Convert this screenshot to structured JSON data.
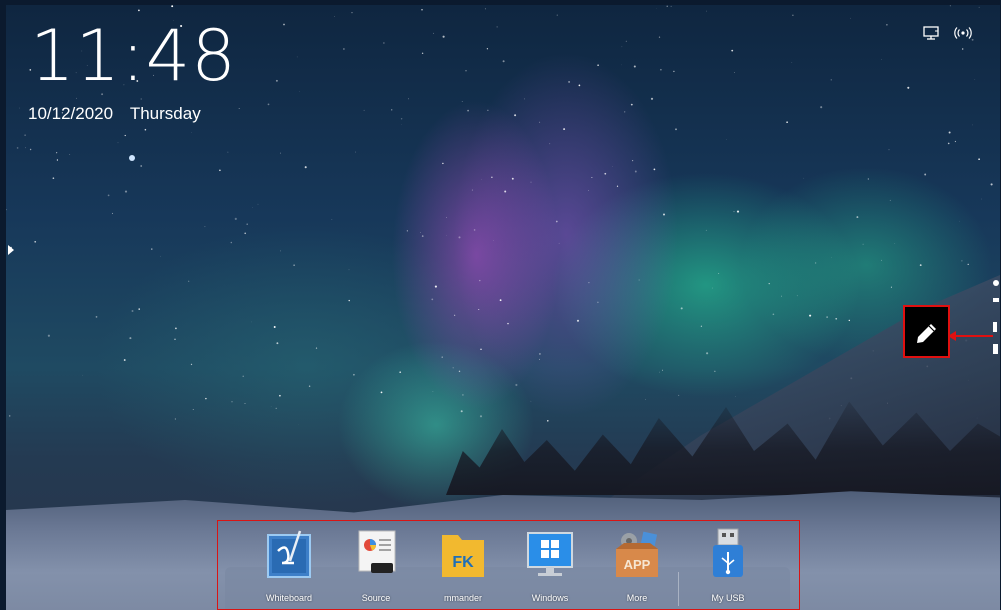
{
  "clock": {
    "time": "11:48",
    "date": "10/12/2020",
    "weekday": "Thursday"
  },
  "status_icons": [
    "monitor-icon",
    "wireless-icon"
  ],
  "floating_tool": {
    "icon": "pen-icon"
  },
  "dock": {
    "items": [
      {
        "label": "Whiteboard",
        "icon": "whiteboard-icon"
      },
      {
        "label": "Source",
        "icon": "source-icon"
      },
      {
        "label": "mmander",
        "icon": "file-commander-icon",
        "badge_text": "FK"
      },
      {
        "label": "Windows",
        "icon": "windows-icon"
      },
      {
        "label": "More",
        "icon": "app-box-icon",
        "badge_text": "APP"
      },
      {
        "label": "My USB",
        "icon": "usb-icon"
      }
    ]
  },
  "colors": {
    "highlight": "#e01010",
    "folder": "#f2b92f",
    "windows_blue": "#2a8ee8"
  }
}
